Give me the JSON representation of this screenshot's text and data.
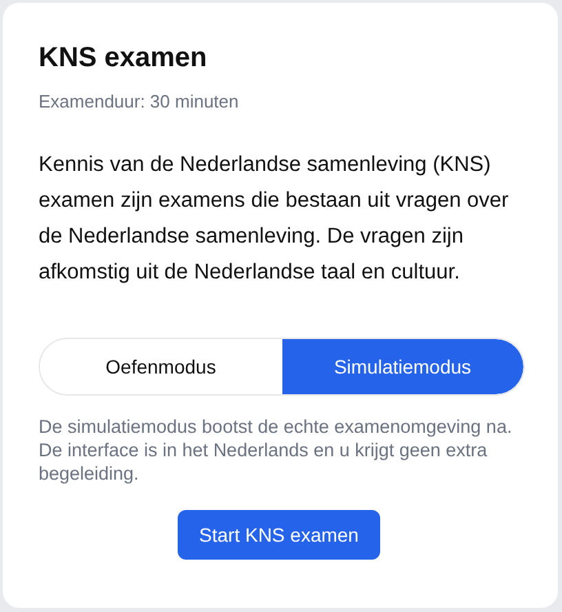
{
  "card": {
    "title": "KNS examen",
    "duration": "Examenduur: 30 minuten",
    "description": "Kennis van de Nederlandse samenleving (KNS) examen zijn examens die bestaan uit vragen over de Nederlandse samenleving. De vragen zijn afkomstig uit de Nederlandse taal en cultuur.",
    "modes": [
      {
        "label": "Oefenmodus",
        "selected": false
      },
      {
        "label": "Simulatiemodus",
        "selected": true
      }
    ],
    "mode_note": "De simulatiemodus bootst de echte examenomgeving na. De interface is in het Nederlands en u krijgt geen extra begeleiding.",
    "start_button": "Start KNS examen"
  }
}
